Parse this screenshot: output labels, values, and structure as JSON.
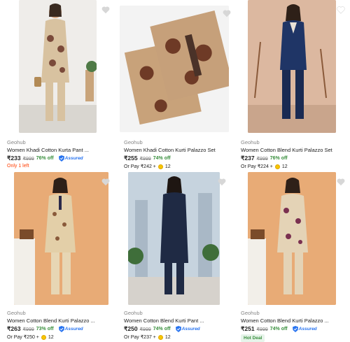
{
  "colors": {
    "accent": "#2874f0",
    "discount": "#388e3c",
    "stock_warning": "#ff3d00"
  },
  "products": [
    {
      "brand": "Geohub",
      "title": "Women Khadi Cotton Kurta Pant ...",
      "price": "₹233",
      "mrp": "₹999",
      "discount": "76% off",
      "assured": "Assured",
      "stock_note": "Only 1 left"
    },
    {
      "brand": "Geohub",
      "title": "Women Khadi Cotton Kurti Palazzo Set",
      "price": "₹255",
      "mrp": "₹999",
      "discount": "74% off",
      "or_pay": "Or Pay ₹242 +",
      "coins": "12"
    },
    {
      "brand": "Geohub",
      "title": "Women Cotton Blend Kurti Palazzo Set",
      "price": "₹237",
      "mrp": "₹999",
      "discount": "76% off",
      "or_pay": "Or Pay ₹224 +",
      "coins": "12"
    },
    {
      "brand": "Geohub",
      "title": "Women Cotton Blend Kurti Palazzo ...",
      "price": "₹263",
      "mrp": "₹999",
      "discount": "73% off",
      "assured": "Assured",
      "or_pay": "Or Pay ₹250 +",
      "coins": "12"
    },
    {
      "brand": "Geohub",
      "title": "Women Cotton Blend Kurti Pant ...",
      "price": "₹250",
      "mrp": "₹999",
      "discount": "74% off",
      "assured": "Assured",
      "or_pay": "Or Pay ₹237 +",
      "coins": "12"
    },
    {
      "brand": "Geohub",
      "title": "Women Cotton Blend Kurti Palazzo ...",
      "price": "₹251",
      "mrp": "₹999",
      "discount": "74% off",
      "assured": "Assured",
      "badge": "Hot Deal"
    }
  ]
}
